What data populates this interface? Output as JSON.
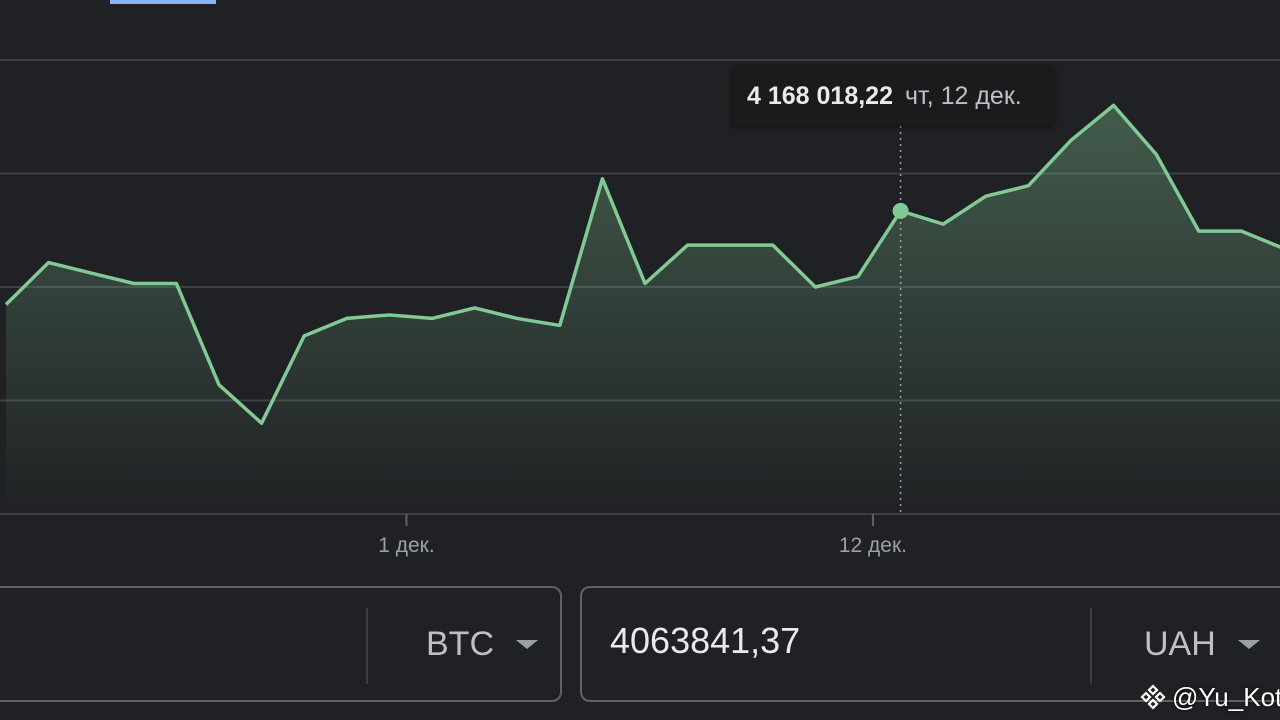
{
  "tooltip": {
    "value": "4 168 018,22",
    "date": "чт, 12 дек."
  },
  "chart_data": {
    "type": "line",
    "xlabel": "",
    "ylabel": "",
    "x_ticks": [
      "1 дек.",
      "12 дек."
    ],
    "series": [
      {
        "values": [
          3.9,
          4.02,
          3.99,
          3.96,
          3.96,
          3.67,
          3.56,
          3.81,
          3.86,
          3.87,
          3.86,
          3.89,
          3.86,
          3.84,
          4.26,
          3.96,
          4.07,
          4.07,
          4.07,
          3.95,
          3.98,
          4.168,
          4.13,
          4.21,
          4.24,
          4.37,
          4.47,
          4.33,
          4.11,
          4.11,
          4.06
        ]
      }
    ],
    "highlighted_index": 21,
    "ylim": [
      3.3,
      4.6
    ],
    "grid": true,
    "fill_under_line": true,
    "line_color": "#81c995"
  },
  "converter": {
    "left": {
      "value": "",
      "currency": "BTC"
    },
    "right": {
      "value": "4063841,37",
      "currency": "UAH"
    }
  },
  "watermark": {
    "text": "@Yu_Kot"
  }
}
